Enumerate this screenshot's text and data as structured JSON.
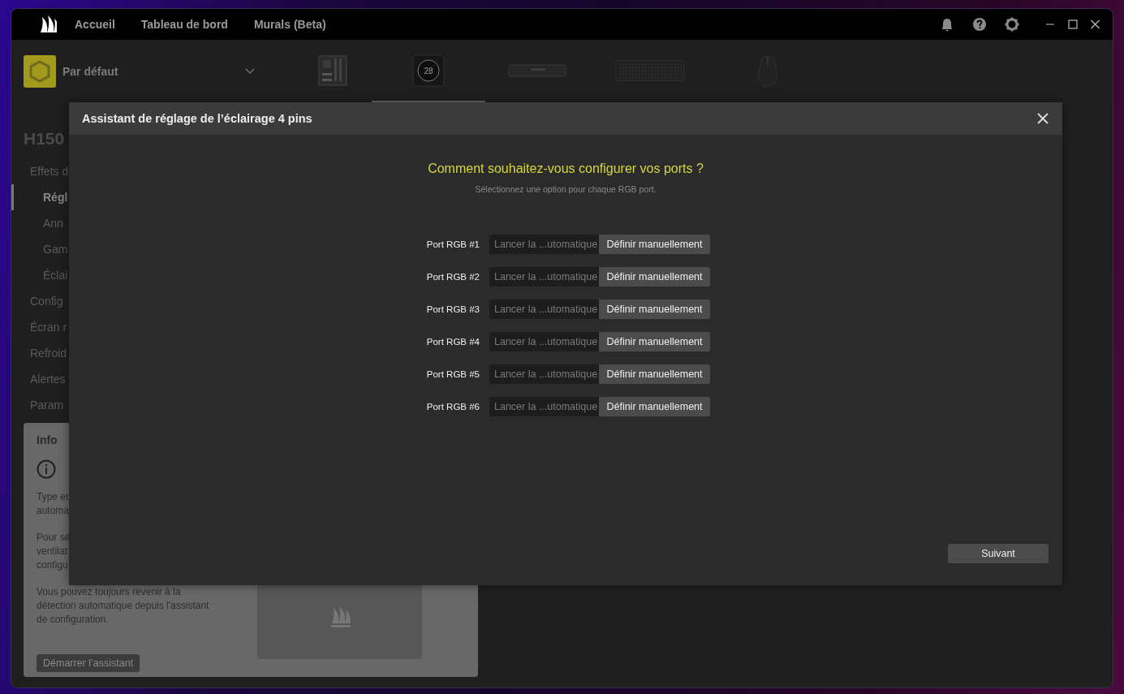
{
  "title_bar": {
    "nav": [
      {
        "label": "Accueil"
      },
      {
        "label": "Tableau de bord"
      },
      {
        "label": "Murals (Beta)"
      }
    ]
  },
  "profile": {
    "name": "Par défaut"
  },
  "devices": [
    {
      "kind": "motherboard",
      "selected": false
    },
    {
      "kind": "cooler",
      "display": "28",
      "selected": true
    },
    {
      "kind": "memory",
      "selected": false
    },
    {
      "kind": "keyboard",
      "selected": false
    },
    {
      "kind": "mouse",
      "selected": false
    }
  ],
  "sidebar": {
    "title": "H150",
    "items": [
      {
        "label": "Effets d",
        "selected": false,
        "children": [
          {
            "label": "Régl",
            "selected": true
          },
          {
            "label": "Ann",
            "selected": false
          },
          {
            "label": "Gam",
            "selected": false
          },
          {
            "label": "Éclai",
            "selected": false
          }
        ]
      },
      {
        "label": "Config",
        "selected": false
      },
      {
        "label": "Écran r",
        "selected": false
      },
      {
        "label": "Refroid",
        "selected": false
      },
      {
        "label": "Alertes",
        "selected": false
      },
      {
        "label": "Param",
        "selected": false
      }
    ]
  },
  "info": {
    "title": "Info",
    "paragraphs": [
      [
        "Type et",
        "automa"
      ],
      [
        "Pour sé",
        "ventilat",
        "configu"
      ],
      [
        "Vous pouvez toujours revenir à la",
        "détection automatique depuis l'assistant",
        "de configuration."
      ]
    ],
    "button": "Démarrer l’assistant"
  },
  "dialog": {
    "title": "Assistant de réglage de l’éclairage 4 pins",
    "heading": "Comment souhaitez-vous configurer vos ports ?",
    "subtitle": "Sélectionnez une option pour chaque RGB port.",
    "ports": [
      {
        "label": "Port RGB #1",
        "options": [
          {
            "label": "Lancer la ...utomatique",
            "selected": false
          },
          {
            "label": "Définir manuellement",
            "selected": true
          }
        ]
      },
      {
        "label": "Port RGB #2",
        "options": [
          {
            "label": "Lancer la ...utomatique",
            "selected": false
          },
          {
            "label": "Définir manuellement",
            "selected": true
          }
        ]
      },
      {
        "label": "Port RGB #3",
        "options": [
          {
            "label": "Lancer la ...utomatique",
            "selected": false
          },
          {
            "label": "Définir manuellement",
            "selected": true
          }
        ]
      },
      {
        "label": "Port RGB #4",
        "options": [
          {
            "label": "Lancer la ...utomatique",
            "selected": false
          },
          {
            "label": "Définir manuellement",
            "selected": true
          }
        ]
      },
      {
        "label": "Port RGB #5",
        "options": [
          {
            "label": "Lancer la ...utomatique",
            "selected": false
          },
          {
            "label": "Définir manuellement",
            "selected": true
          }
        ]
      },
      {
        "label": "Port RGB #6",
        "options": [
          {
            "label": "Lancer la ...utomatique",
            "selected": false
          },
          {
            "label": "Définir manuellement",
            "selected": true
          }
        ]
      }
    ],
    "next_button": "Suivant"
  }
}
